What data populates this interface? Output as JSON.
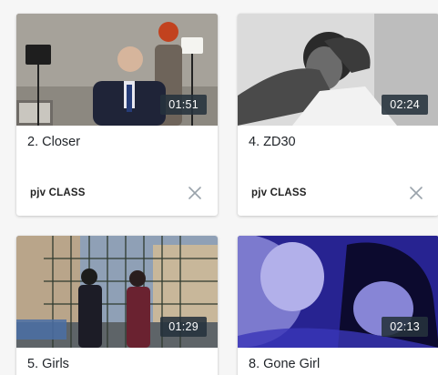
{
  "videos": [
    {
      "title": "2. Closer",
      "duration": "01:51",
      "author": "pjv CLASS",
      "remove_icon": "close-icon"
    },
    {
      "title": "4. ZD30",
      "duration": "02:24",
      "author": "pjv CLASS",
      "remove_icon": "close-icon"
    },
    {
      "title": "5. Girls",
      "duration": "01:29"
    },
    {
      "title": "8. Gone Girl",
      "duration": "02:13"
    }
  ],
  "colors": {
    "page_background": "#f6f6f6",
    "card_background": "#ffffff",
    "duration_badge": "#26323c",
    "remove_icon": "#9aa3ab"
  }
}
